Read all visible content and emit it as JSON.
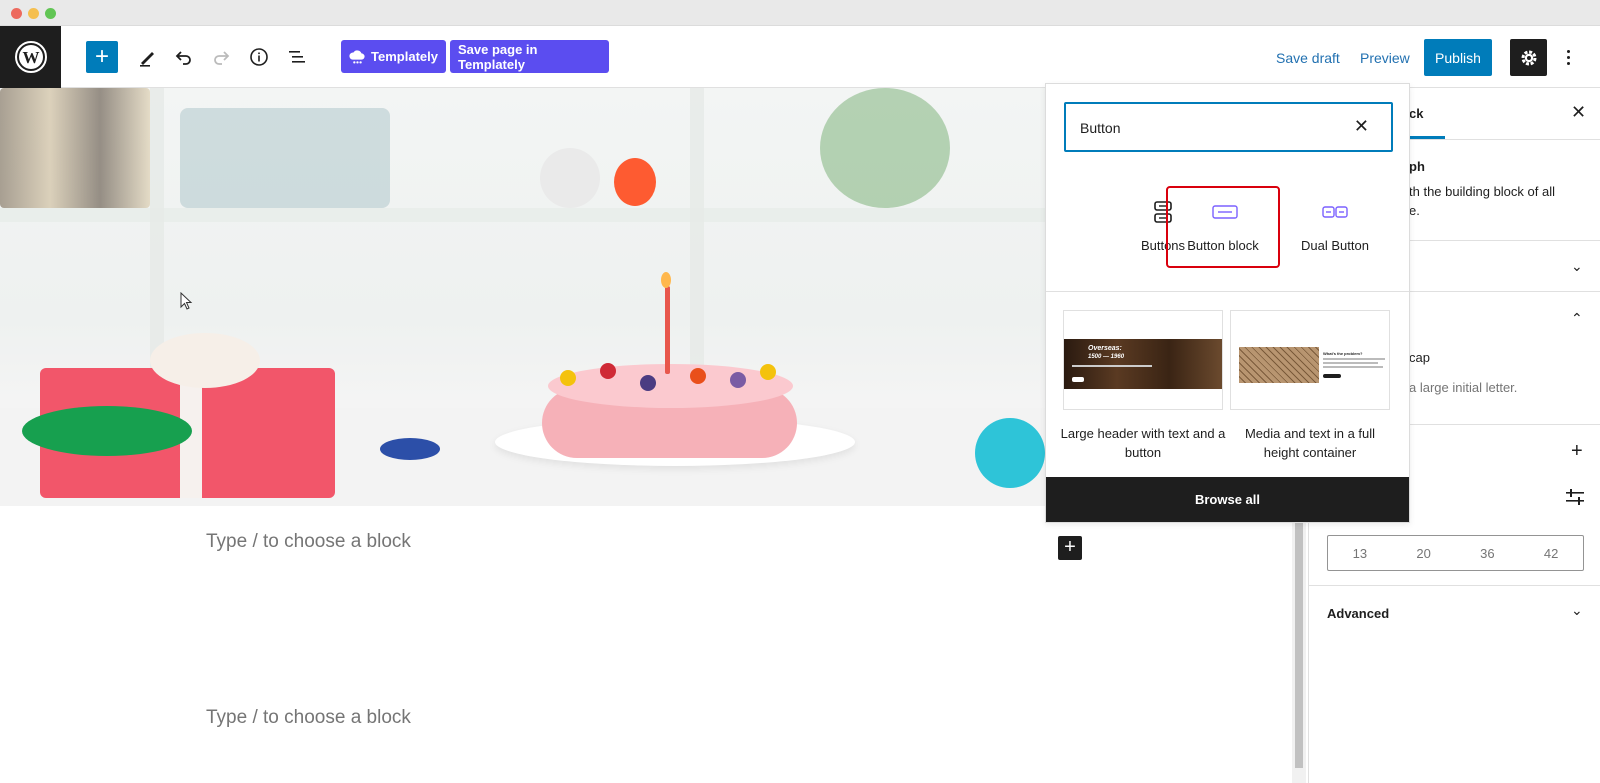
{
  "toolbar": {
    "templately_label": "Templately",
    "save_templately_label": "Save page in Templately",
    "save_draft_label": "Save draft",
    "preview_label": "Preview",
    "publish_label": "Publish"
  },
  "canvas": {
    "placeholder_1": "Type / to choose a block",
    "placeholder_2": "Type / to choose a block"
  },
  "inserter": {
    "search_value": "Button",
    "blocks": [
      {
        "label": "Buttons",
        "icon": "buttons-icon"
      },
      {
        "label": "Button block",
        "icon": "button-block-icon"
      },
      {
        "label": "Dual Button",
        "icon": "dual-button-icon"
      }
    ],
    "patterns": [
      {
        "label": "Large header with text and a button",
        "preview_title": "Overseas:",
        "preview_sub": "1500 — 1960"
      },
      {
        "label": "Media and text in a full height container",
        "preview_title": "What's the problem?"
      }
    ],
    "browse_all_label": "Browse all"
  },
  "sidebar": {
    "tab_label": "ck",
    "block_title": "ph",
    "block_desc_1": "th the building block of all",
    "block_desc_2": "e.",
    "dropcap_label": "cap",
    "dropcap_desc": "a large initial letter.",
    "font_sizes": [
      "13",
      "20",
      "36",
      "42"
    ],
    "advanced_label": "Advanced"
  },
  "colors": {
    "accent": "#007cba",
    "templately": "#5b4df0",
    "dark": "#1e1e1e",
    "highlight": "#d9000d"
  }
}
